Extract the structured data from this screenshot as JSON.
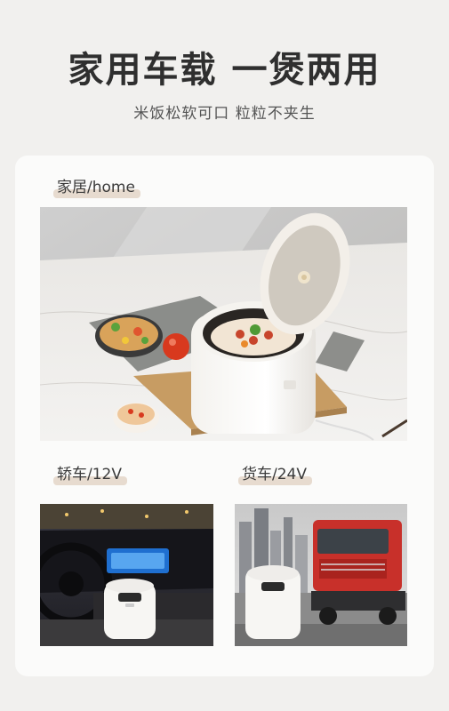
{
  "heading": {
    "title": "家用车载 一煲两用",
    "subtitle": "米饭松软可口 粒粒不夹生"
  },
  "sections": {
    "home": {
      "label": "家居/home",
      "image": "rice-cooker-kitchen-photo"
    },
    "car": {
      "label": "轿车/12V",
      "image": "rice-cooker-car-interior-photo"
    },
    "truck": {
      "label": "货车/24V",
      "image": "rice-cooker-truck-photo"
    }
  },
  "colors": {
    "background": "#f1f0ee",
    "card": "#fbfbfa",
    "label_highlight": "#e7dbcf",
    "truck_red": "#c8302a"
  }
}
